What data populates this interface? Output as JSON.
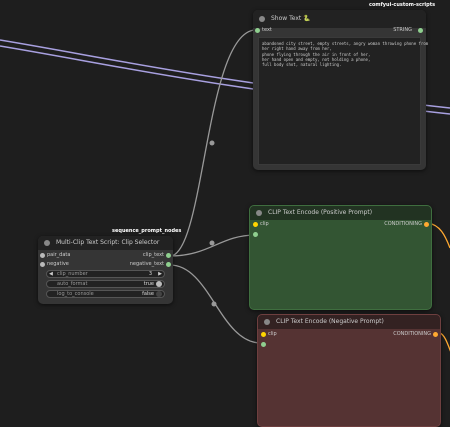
{
  "groups": {
    "custom_scripts": "comfyui-custom-scripts",
    "sequence_prompt": "sequence_prompt_nodes"
  },
  "show_text": {
    "title": "Show Text 🐍",
    "input_label": "text",
    "output_label": "STRING",
    "text": "abandoned city street, empty streets, angry woman throwing phone from\nher right hand away from her,\nphone flying through the air in front of her,\nher hand open and empty, not holding a phone,\nfull body shot, natural lighting."
  },
  "clip_selector": {
    "title": "Multi-Clip Text Script: Clip Selector",
    "inputs": [
      "pair_data",
      "negative"
    ],
    "outputs": [
      "clip_text",
      "negative_text"
    ],
    "widgets": [
      {
        "label": "clip_number",
        "value": "3",
        "type": "number"
      },
      {
        "label": "auto_format",
        "value": "true",
        "type": "toggle"
      },
      {
        "label": "log_to_console",
        "value": "false",
        "type": "toggle"
      }
    ]
  },
  "clip_positive": {
    "title": "CLIP Text Encode (Positive Prompt)",
    "input_label": "clip",
    "output_label": "CONDITIONING"
  },
  "clip_negative": {
    "title": "CLIP Text Encode (Negative Prompt)",
    "input_label": "clip",
    "output_label": "CONDITIONING"
  },
  "colors": {
    "canvas": "#1e1e1e",
    "node_body": "#353535",
    "node_title": "#222222",
    "positive_body": "#335533",
    "positive_title": "#223322",
    "negative_body": "#553333",
    "negative_title": "#332222",
    "wire_clip": "#ffd500",
    "wire_text": "#999999",
    "wire_conditioning": "#ffa931",
    "wire_purple": "#a8a0e0"
  }
}
